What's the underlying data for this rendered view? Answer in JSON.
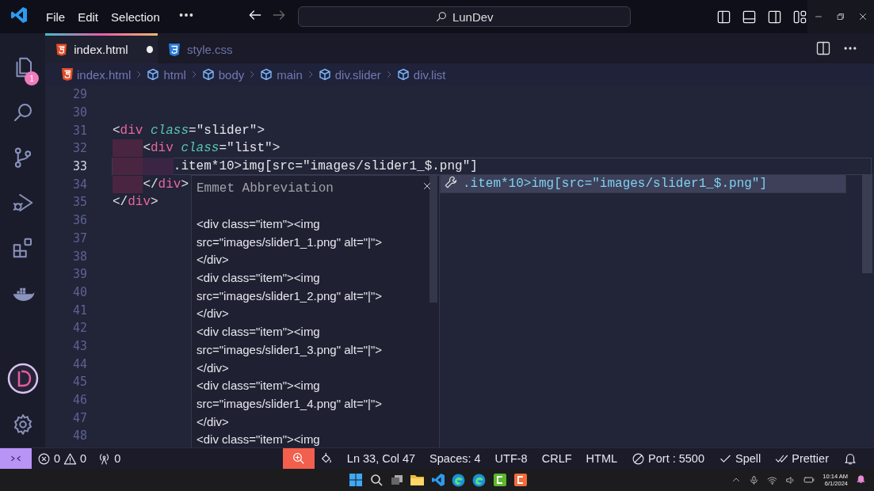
{
  "title_bar": {
    "menu": [
      "File",
      "Edit",
      "Selection"
    ],
    "command_center": "LunDev"
  },
  "activity_bar": {
    "items": [
      {
        "kind": "explorer",
        "badge": "1"
      },
      {
        "kind": "search"
      },
      {
        "kind": "source-control"
      },
      {
        "kind": "run-debug"
      },
      {
        "kind": "extensions"
      },
      {
        "kind": "docker"
      }
    ],
    "bottom": [
      {
        "kind": "account"
      },
      {
        "kind": "settings"
      }
    ]
  },
  "tabs": [
    {
      "label": "index.html",
      "kind": "html",
      "selected": true,
      "modified": true
    },
    {
      "label": "style.css",
      "kind": "css",
      "selected": false,
      "modified": false
    }
  ],
  "breadcrumb": [
    {
      "label": "index.html",
      "kind": "file"
    },
    {
      "label": "html",
      "kind": "element"
    },
    {
      "label": "body",
      "kind": "element"
    },
    {
      "label": "main",
      "kind": "element"
    },
    {
      "label": "div.slider",
      "kind": "element"
    },
    {
      "label": "div.list",
      "kind": "element"
    }
  ],
  "editor": {
    "lines": [
      {
        "number": "29",
        "current": false
      },
      {
        "number": "30",
        "current": false
      },
      {
        "number": "31",
        "current": false,
        "tokens": [
          {
            "kind": "text",
            "text": "<"
          },
          {
            "kind": "tag",
            "text": "div"
          },
          {
            "kind": "attr",
            "text": "class"
          },
          {
            "kind": "text",
            "text": "=\"slider\">"
          }
        ]
      },
      {
        "number": "32",
        "current": false,
        "tokens": [
          {
            "kind": "text",
            "text": "    <"
          },
          {
            "kind": "tag",
            "text": "div"
          },
          {
            "kind": "attr",
            "text": "class"
          },
          {
            "kind": "text",
            "text": "=\"list\">"
          }
        ]
      },
      {
        "number": "33",
        "current": true,
        "tokens": [
          {
            "kind": "text",
            "text": "        .item*10>img[src=\"images/slider1_$.png\"]"
          }
        ]
      },
      {
        "number": "34",
        "current": false,
        "tokens": [
          {
            "kind": "text",
            "text": "    </"
          },
          {
            "kind": "tag",
            "text": "div"
          },
          {
            "kind": "text",
            "text": ">"
          }
        ]
      },
      {
        "number": "35",
        "current": false,
        "tokens": [
          {
            "kind": "text",
            "text": "</"
          },
          {
            "kind": "tag",
            "text": "div"
          },
          {
            "kind": "text",
            "text": ">"
          }
        ]
      },
      {
        "number": "36",
        "current": false
      },
      {
        "number": "37",
        "current": false
      },
      {
        "number": "38",
        "current": false
      },
      {
        "number": "39",
        "current": false
      },
      {
        "number": "40",
        "current": false
      },
      {
        "number": "41",
        "current": false
      },
      {
        "number": "42",
        "current": false
      },
      {
        "number": "43",
        "current": false
      },
      {
        "number": "44",
        "current": false
      },
      {
        "number": "45",
        "current": false
      },
      {
        "number": "46",
        "current": false
      },
      {
        "number": "47",
        "current": false
      },
      {
        "number": "48",
        "current": false
      }
    ]
  },
  "emmet_popup": {
    "title": "Emmet Abbreviation",
    "preview": [
      "<div class=\"item\"><img",
      "src=\"images/slider1_1.png\" alt=\"|\">",
      "</div>",
      "<div class=\"item\"><img",
      "src=\"images/slider1_2.png\" alt=\"|\">",
      "</div>",
      "<div class=\"item\"><img",
      "src=\"images/slider1_3.png\" alt=\"|\">",
      "</div>",
      "<div class=\"item\"><img",
      "src=\"images/slider1_4.png\" alt=\"|\">",
      "</div>",
      "<div class=\"item\"><img"
    ]
  },
  "suggestion": {
    "label": ".item*10>img[src=\"images/slider1_$.png\"]",
    "selected": true
  },
  "status_bar": {
    "errors": "0",
    "warnings": "0",
    "ports": "0",
    "position": "Ln 33, Col 47",
    "spaces": "Spaces: 4",
    "encoding": "UTF-8",
    "eol": "CRLF",
    "language": "HTML",
    "live_server": "Port : 5500",
    "spell": "Spell",
    "prettier": "Prettier"
  },
  "taskbar": {
    "apps": [
      {
        "kind": "start"
      },
      {
        "kind": "search"
      },
      {
        "kind": "task-view"
      },
      {
        "kind": "folder"
      },
      {
        "kind": "code"
      },
      {
        "kind": "edge"
      },
      {
        "kind": "edge"
      },
      {
        "kind": "green-app"
      },
      {
        "kind": "orange-app"
      }
    ],
    "time": "10:14 AM",
    "date": "6/1/2024"
  }
}
